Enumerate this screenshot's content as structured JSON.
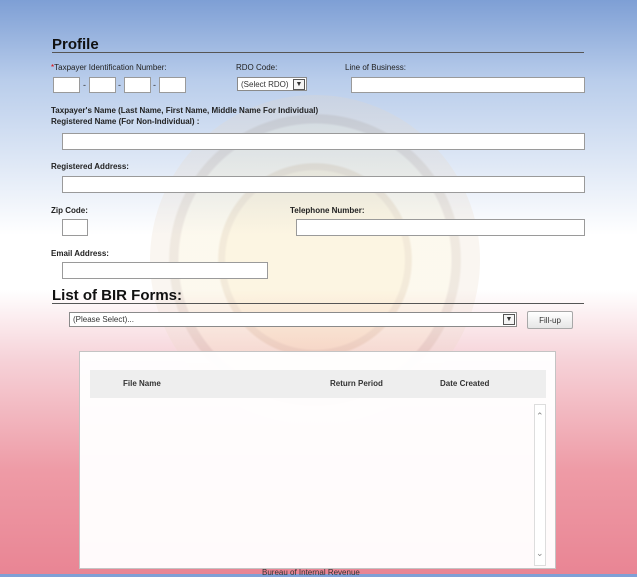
{
  "profile": {
    "title": "Profile",
    "tin_asterisk": "*",
    "tin_label": "Taxpayer Identification Number:",
    "tin_sep": "-",
    "rdo_label": "RDO Code:",
    "rdo_selected": "(Select RDO)",
    "lob_label": "Line of Business:",
    "name_label_1": "Taxpayer's Name (Last Name, First Name, Middle Name For Individual)",
    "name_label_2": "Registered Name (For Non-Individual) :",
    "address_label": "Registered Address:",
    "zip_label": "Zip Code:",
    "phone_label": "Telephone Number:",
    "email_label": "Email Address:"
  },
  "forms": {
    "title": "List of BIR Forms:",
    "select_value": "(Please Select)...",
    "fillup_label": "Fill-up",
    "columns": [
      "File Name",
      "Return Period",
      "Date Created"
    ]
  },
  "footer": {
    "text": "Bureau of Internal Revenue"
  }
}
